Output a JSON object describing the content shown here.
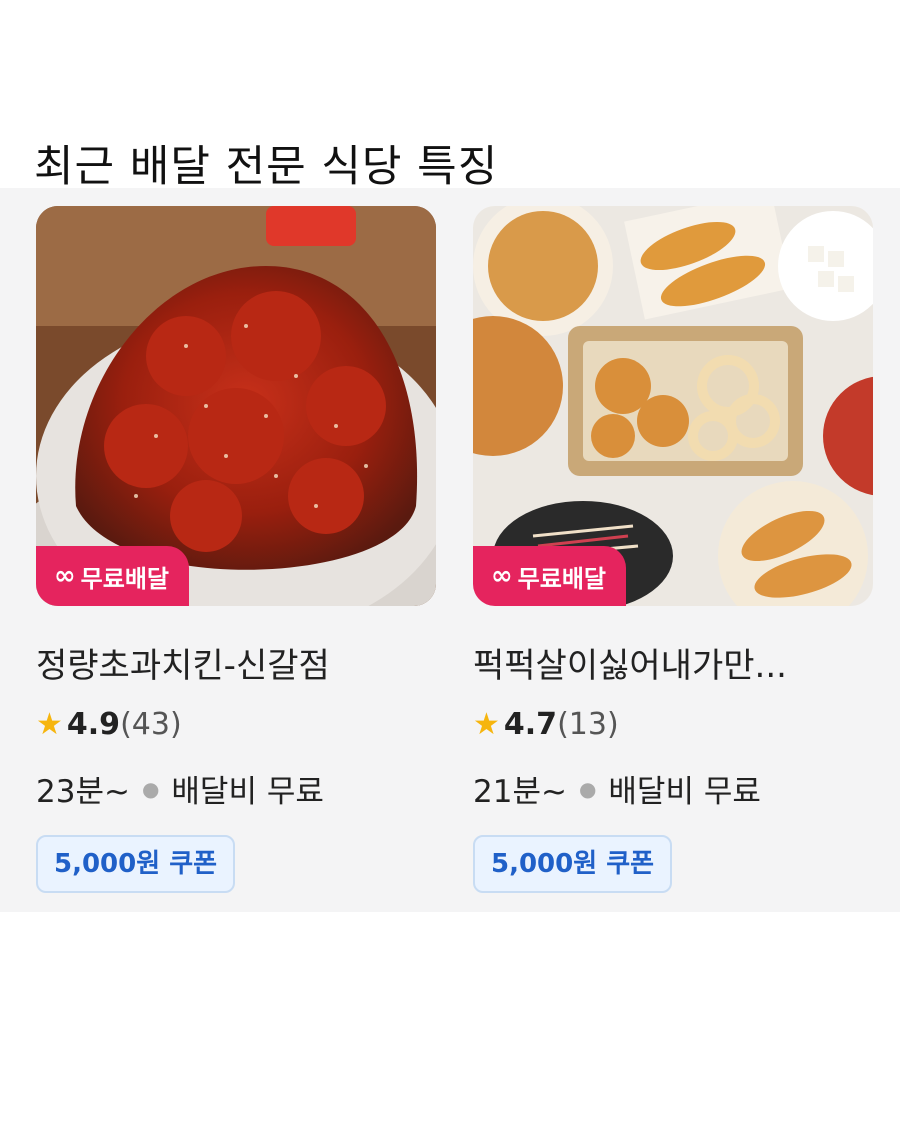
{
  "page": {
    "title": "최근 배달 전문 식당 특징"
  },
  "stores": [
    {
      "name": "정량초과치킨-신갈점",
      "badge": "무료배달",
      "badge_icon": "infinity-icon",
      "rating": "4.9",
      "reviews": "(43)",
      "time": "23분~",
      "fee": "배달비 무료",
      "coupon": "5,000원 쿠폰",
      "image": "spicy-glazed-fried-chicken-photo"
    },
    {
      "name": "퍽퍽살이싫어내가만...",
      "badge": "무료배달",
      "badge_icon": "infinity-icon",
      "rating": "4.7",
      "reviews": "(13)",
      "time": "21분~",
      "fee": "배달비 무료",
      "coupon": "5,000원 쿠폰",
      "image": "fried-chicken-assortment-photo"
    }
  ],
  "colors": {
    "badge": "#e5245e",
    "star": "#f6b50e",
    "coupon_text": "#2060c8",
    "coupon_bg": "#eaf3ff",
    "panel_bg": "#f4f4f5"
  }
}
